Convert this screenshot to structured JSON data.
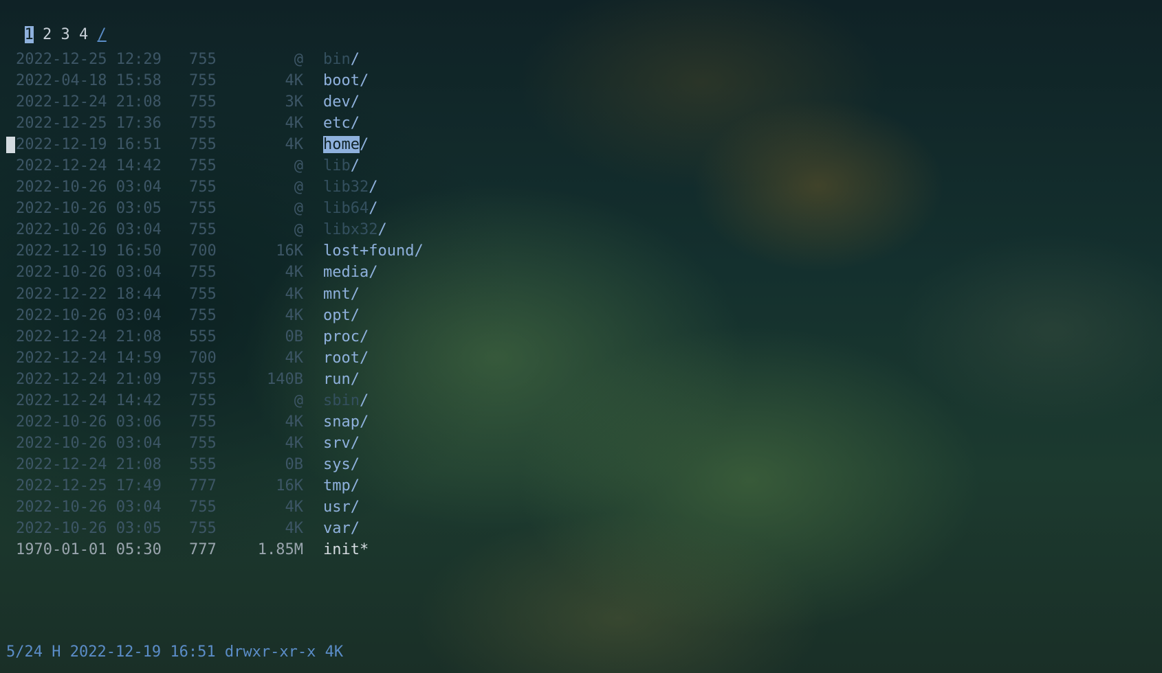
{
  "tabs": [
    {
      "label": "1",
      "active": true
    },
    {
      "label": "2",
      "active": false
    },
    {
      "label": "3",
      "active": false
    },
    {
      "label": "4",
      "active": false
    }
  ],
  "current_path": "/",
  "entries": [
    {
      "date": "2022-12-25 12:29",
      "perm": "755",
      "size": "@",
      "name": "bin",
      "suffix": "/",
      "kind": "link"
    },
    {
      "date": "2022-04-18 15:58",
      "perm": "755",
      "size": "4K",
      "name": "boot",
      "suffix": "/",
      "kind": "dir"
    },
    {
      "date": "2022-12-24 21:08",
      "perm": "755",
      "size": "3K",
      "name": "dev",
      "suffix": "/",
      "kind": "dir"
    },
    {
      "date": "2022-12-25 17:36",
      "perm": "755",
      "size": "4K",
      "name": "etc",
      "suffix": "/",
      "kind": "dir"
    },
    {
      "date": "2022-12-19 16:51",
      "perm": "755",
      "size": "4K",
      "name": "home",
      "suffix": "/",
      "kind": "dir",
      "selected": true
    },
    {
      "date": "2022-12-24 14:42",
      "perm": "755",
      "size": "@",
      "name": "lib",
      "suffix": "/",
      "kind": "link"
    },
    {
      "date": "2022-10-26 03:04",
      "perm": "755",
      "size": "@",
      "name": "lib32",
      "suffix": "/",
      "kind": "link"
    },
    {
      "date": "2022-10-26 03:05",
      "perm": "755",
      "size": "@",
      "name": "lib64",
      "suffix": "/",
      "kind": "link"
    },
    {
      "date": "2022-10-26 03:04",
      "perm": "755",
      "size": "@",
      "name": "libx32",
      "suffix": "/",
      "kind": "link"
    },
    {
      "date": "2022-12-19 16:50",
      "perm": "700",
      "size": "16K",
      "name": "lost+found",
      "suffix": "/",
      "kind": "dir"
    },
    {
      "date": "2022-10-26 03:04",
      "perm": "755",
      "size": "4K",
      "name": "media",
      "suffix": "/",
      "kind": "dir"
    },
    {
      "date": "2022-12-22 18:44",
      "perm": "755",
      "size": "4K",
      "name": "mnt",
      "suffix": "/",
      "kind": "dir"
    },
    {
      "date": "2022-10-26 03:04",
      "perm": "755",
      "size": "4K",
      "name": "opt",
      "suffix": "/",
      "kind": "dir"
    },
    {
      "date": "2022-12-24 21:08",
      "perm": "555",
      "size": "0B",
      "name": "proc",
      "suffix": "/",
      "kind": "dir"
    },
    {
      "date": "2022-12-24 14:59",
      "perm": "700",
      "size": "4K",
      "name": "root",
      "suffix": "/",
      "kind": "dir"
    },
    {
      "date": "2022-12-24 21:09",
      "perm": "755",
      "size": "140B",
      "name": "run",
      "suffix": "/",
      "kind": "dir"
    },
    {
      "date": "2022-12-24 14:42",
      "perm": "755",
      "size": "@",
      "name": "sbin",
      "suffix": "/",
      "kind": "link"
    },
    {
      "date": "2022-10-26 03:06",
      "perm": "755",
      "size": "4K",
      "name": "snap",
      "suffix": "/",
      "kind": "dir"
    },
    {
      "date": "2022-10-26 03:04",
      "perm": "755",
      "size": "4K",
      "name": "srv",
      "suffix": "/",
      "kind": "dir"
    },
    {
      "date": "2022-12-24 21:08",
      "perm": "555",
      "size": "0B",
      "name": "sys",
      "suffix": "/",
      "kind": "dir"
    },
    {
      "date": "2022-12-25 17:49",
      "perm": "777",
      "size": "16K",
      "name": "tmp",
      "suffix": "/",
      "kind": "dir"
    },
    {
      "date": "2022-10-26 03:04",
      "perm": "755",
      "size": "4K",
      "name": "usr",
      "suffix": "/",
      "kind": "dir"
    },
    {
      "date": "2022-10-26 03:05",
      "perm": "755",
      "size": "4K",
      "name": "var",
      "suffix": "/",
      "kind": "dir"
    },
    {
      "date": "1970-01-01 05:30",
      "perm": "777",
      "size": "1.85M",
      "name": "init",
      "suffix": "*",
      "kind": "exec"
    }
  ],
  "status_bar": "5/24 H 2022-12-19 16:51 drwxr-xr-x 4K",
  "colors": {
    "accent": "#8fb1dd",
    "status": "#5b8dc8",
    "dim": "#3d5666"
  }
}
